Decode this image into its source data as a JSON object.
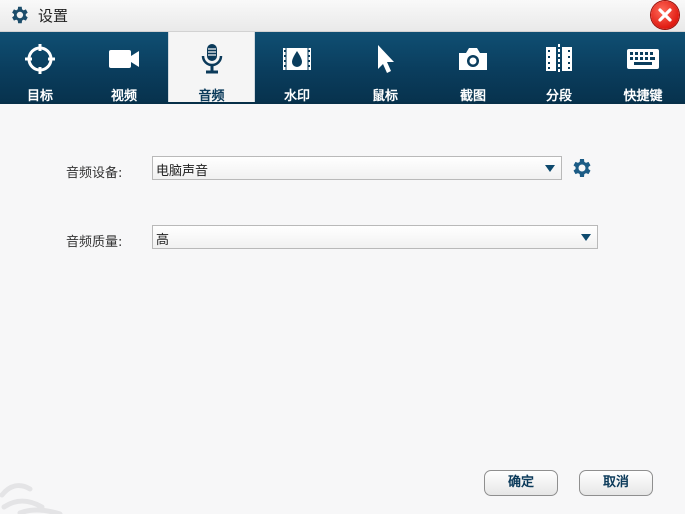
{
  "window": {
    "title": "设置",
    "icons": {
      "title": "gear-icon",
      "close": "close-icon"
    }
  },
  "tabs": [
    {
      "label": "目标",
      "icon": "target-icon",
      "active": false
    },
    {
      "label": "视频",
      "icon": "video-camera-icon",
      "active": false
    },
    {
      "label": "音频",
      "icon": "microphone-icon",
      "active": true
    },
    {
      "label": "水印",
      "icon": "watermark-icon",
      "active": false
    },
    {
      "label": "鼠标",
      "icon": "cursor-icon",
      "active": false
    },
    {
      "label": "截图",
      "icon": "camera-icon",
      "active": false
    },
    {
      "label": "分段",
      "icon": "segment-icon",
      "active": false
    },
    {
      "label": "快捷键",
      "icon": "keyboard-icon",
      "active": false
    }
  ],
  "audio": {
    "device_label": "音频设备:",
    "device_value": "电脑声音",
    "quality_label": "音频质量:",
    "quality_value": "高"
  },
  "buttons": {
    "ok": "确定",
    "cancel": "取消"
  },
  "colors": {
    "tabbar": "#0a3d5d",
    "accent": "#0e4a6e",
    "close": "#e01b12"
  }
}
